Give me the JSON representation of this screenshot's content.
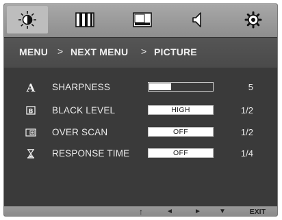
{
  "tabs": [
    {
      "icon": "brightness-icon",
      "active": true
    },
    {
      "icon": "color-bars-icon",
      "active": false
    },
    {
      "icon": "picture-in-picture-icon",
      "active": false
    },
    {
      "icon": "volume-icon",
      "active": false
    },
    {
      "icon": "settings-gear-icon",
      "active": false
    }
  ],
  "breadcrumb": {
    "menu": "MENU",
    "separator": ">",
    "next_menu": "NEXT MENU",
    "current": "PICTURE"
  },
  "settings": [
    {
      "icon": "sharpness-icon",
      "label": "SHARPNESS",
      "type": "slider",
      "level_fraction": 0.35,
      "value": "5"
    },
    {
      "icon": "black-level-icon",
      "label": "BLACK LEVEL",
      "type": "option",
      "option": "HIGH",
      "value": "1/2"
    },
    {
      "icon": "over-scan-icon",
      "label": "OVER SCAN",
      "type": "option",
      "option": "OFF",
      "value": "1/2"
    },
    {
      "icon": "response-time-icon",
      "label": "RESPONSE TIME",
      "type": "option",
      "option": "OFF",
      "value": "1/4"
    }
  ],
  "footer": {
    "up_arrow": "↑",
    "left_arrow": "◄",
    "right_arrow": "►",
    "down_arrow": "▼",
    "exit_label": "EXIT"
  },
  "colors": {
    "panel": "#3a3a3a",
    "icon_bar": "#999999",
    "title_bar": "#505050",
    "text": "#ececec"
  }
}
